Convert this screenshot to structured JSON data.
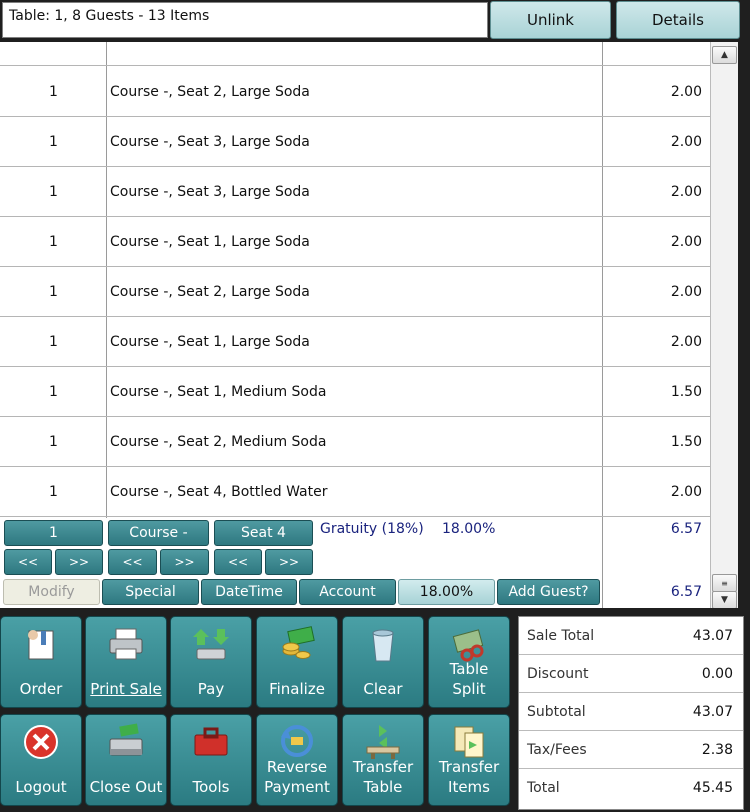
{
  "header": {
    "title": "Table: 1, 8 Guests - 13 Items",
    "unlink_label": "Unlink",
    "details_label": "Details"
  },
  "items": [
    {
      "qty": "1",
      "desc": "Course -, Seat 2, Large Soda",
      "price": "2.00"
    },
    {
      "qty": "1",
      "desc": "Course -, Seat 3, Large Soda",
      "price": "2.00"
    },
    {
      "qty": "1",
      "desc": "Course -, Seat 3, Large Soda",
      "price": "2.00"
    },
    {
      "qty": "1",
      "desc": "Course -, Seat 1, Large Soda",
      "price": "2.00"
    },
    {
      "qty": "1",
      "desc": "Course -, Seat 2, Large Soda",
      "price": "2.00"
    },
    {
      "qty": "1",
      "desc": "Course -, Seat 1, Large Soda",
      "price": "2.00"
    },
    {
      "qty": "1",
      "desc": "Course -, Seat 1, Medium Soda",
      "price": "1.50"
    },
    {
      "qty": "1",
      "desc": "Course -, Seat 2, Medium Soda",
      "price": "1.50"
    },
    {
      "qty": "1",
      "desc": "Course -, Seat 4, Bottled Water",
      "price": "2.00"
    }
  ],
  "controls": {
    "qty_value": "1",
    "course_value": "Course -",
    "seat_value": "Seat 4",
    "prev_label": "<<",
    "next_label": ">>",
    "gratuity_label": "Gratuity (18%)",
    "gratuity_pct": "18.00%",
    "gratuity_amount": "6.57",
    "footer_amount": "6.57",
    "modify_label": "Modify",
    "special_label": "Special",
    "datetime_label": "DateTime",
    "account_label": "Account",
    "pct_button_label": "18.00%",
    "add_guest_label": "Add Guest?"
  },
  "actions": {
    "order": "Order",
    "print_sale": "Print Sale",
    "pay": "Pay",
    "finalize": "Finalize",
    "clear": "Clear",
    "table_split": "Table Split",
    "logout": "Logout",
    "close_out": "Close Out",
    "tools": "Tools",
    "reverse_payment_1": "Reverse",
    "reverse_payment_2": "Payment",
    "transfer_table_1": "Transfer",
    "transfer_table_2": "Table",
    "transfer_items_1": "Transfer",
    "transfer_items_2": "Items"
  },
  "totals": {
    "sale_total_label": "Sale Total",
    "sale_total": "43.07",
    "discount_label": "Discount",
    "discount": "0.00",
    "subtotal_label": "Subtotal",
    "subtotal": "43.07",
    "tax_label": "Tax/Fees",
    "tax": "2.38",
    "total_label": "Total",
    "total": "45.45"
  },
  "colors": {
    "teal_button": "#2e7880",
    "light_button": "#a9d3d6",
    "gratuity_text": "#1a237e"
  }
}
